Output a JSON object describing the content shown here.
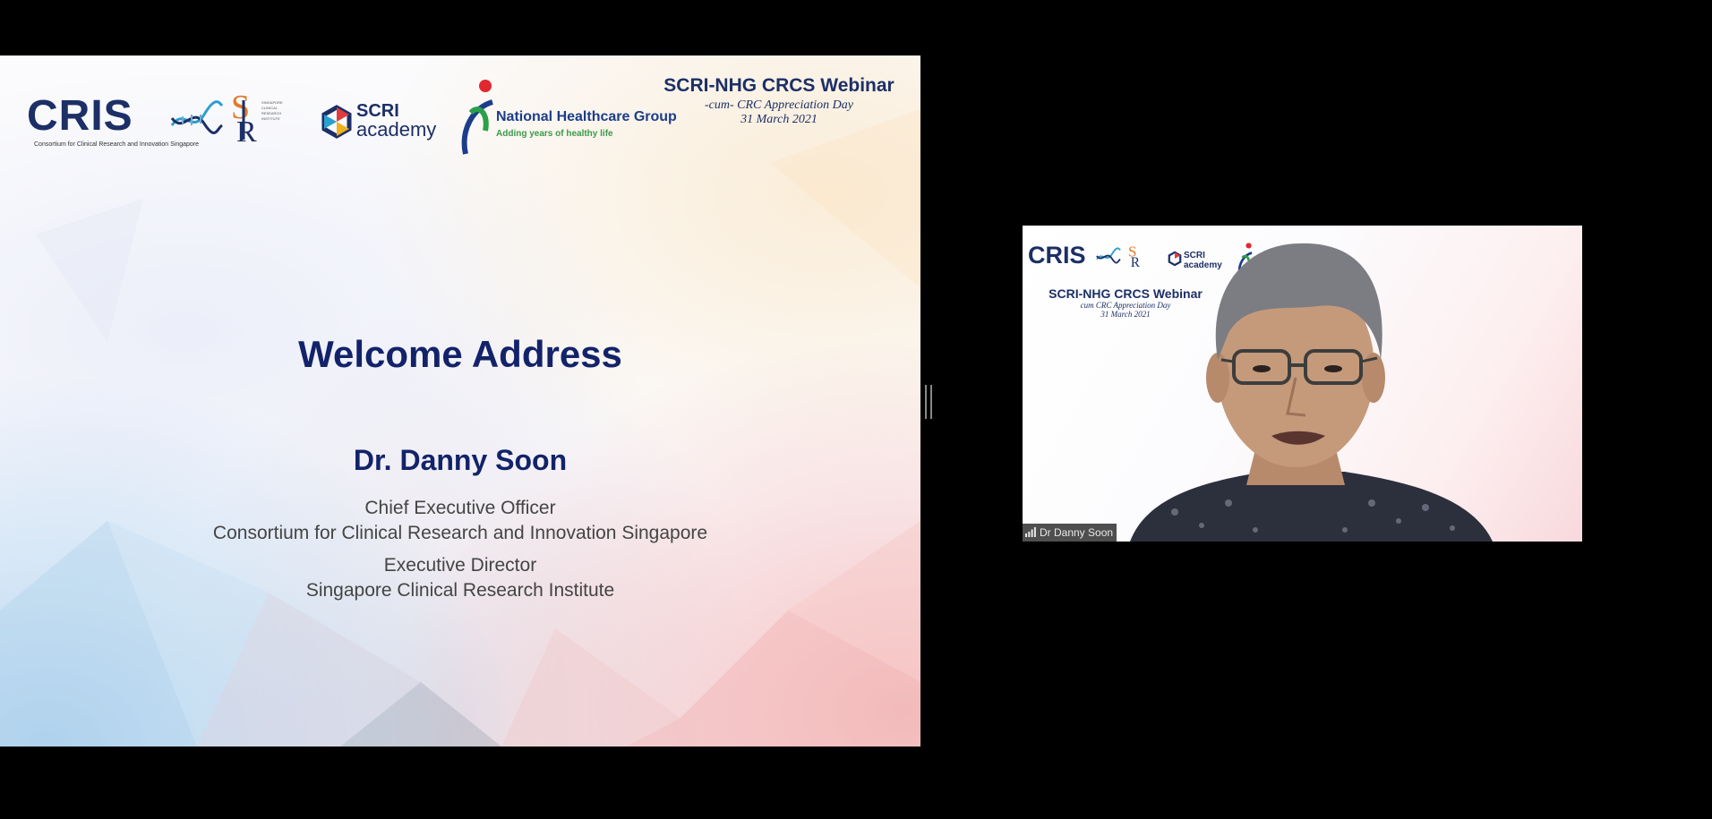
{
  "slide": {
    "logos": {
      "cris": "CRIS",
      "cris_sub": "Consortium for Clinical Research and Innovation Singapore",
      "scri_logo_text": "SINGAPORE CLINICAL RESEARCH INSTITUTE",
      "academy_1": "SCRI",
      "academy_2": "academy",
      "nhg_name": "National Healthcare Group",
      "nhg_tag": "Adding years of healthy life"
    },
    "webinar": {
      "title": "SCRI-NHG CRCS Webinar",
      "subtitle": "-cum- CRC Appreciation Day",
      "date": "31 March 2021"
    },
    "title": "Welcome Address",
    "speaker": "Dr. Danny Soon",
    "role1": "Chief Executive Officer",
    "org1": "Consortium for Clinical Research and Innovation Singapore",
    "role2": "Executive Director",
    "org2": "Singapore Clinical Research Institute"
  },
  "video": {
    "mini_cris": "CRIS",
    "mini_academy": "SCRI academy",
    "mini_webinar_title": "SCRI-NHG CRCS Webinar",
    "mini_webinar_sub": "cum  CRC Appreciation Day",
    "mini_webinar_date": "31 March 2021",
    "participant_name": "Dr Danny Soon"
  },
  "icons": [
    "signal-bars-icon",
    "dna-wave-icon",
    "person-figure-icon",
    "academy-mark-icon"
  ]
}
